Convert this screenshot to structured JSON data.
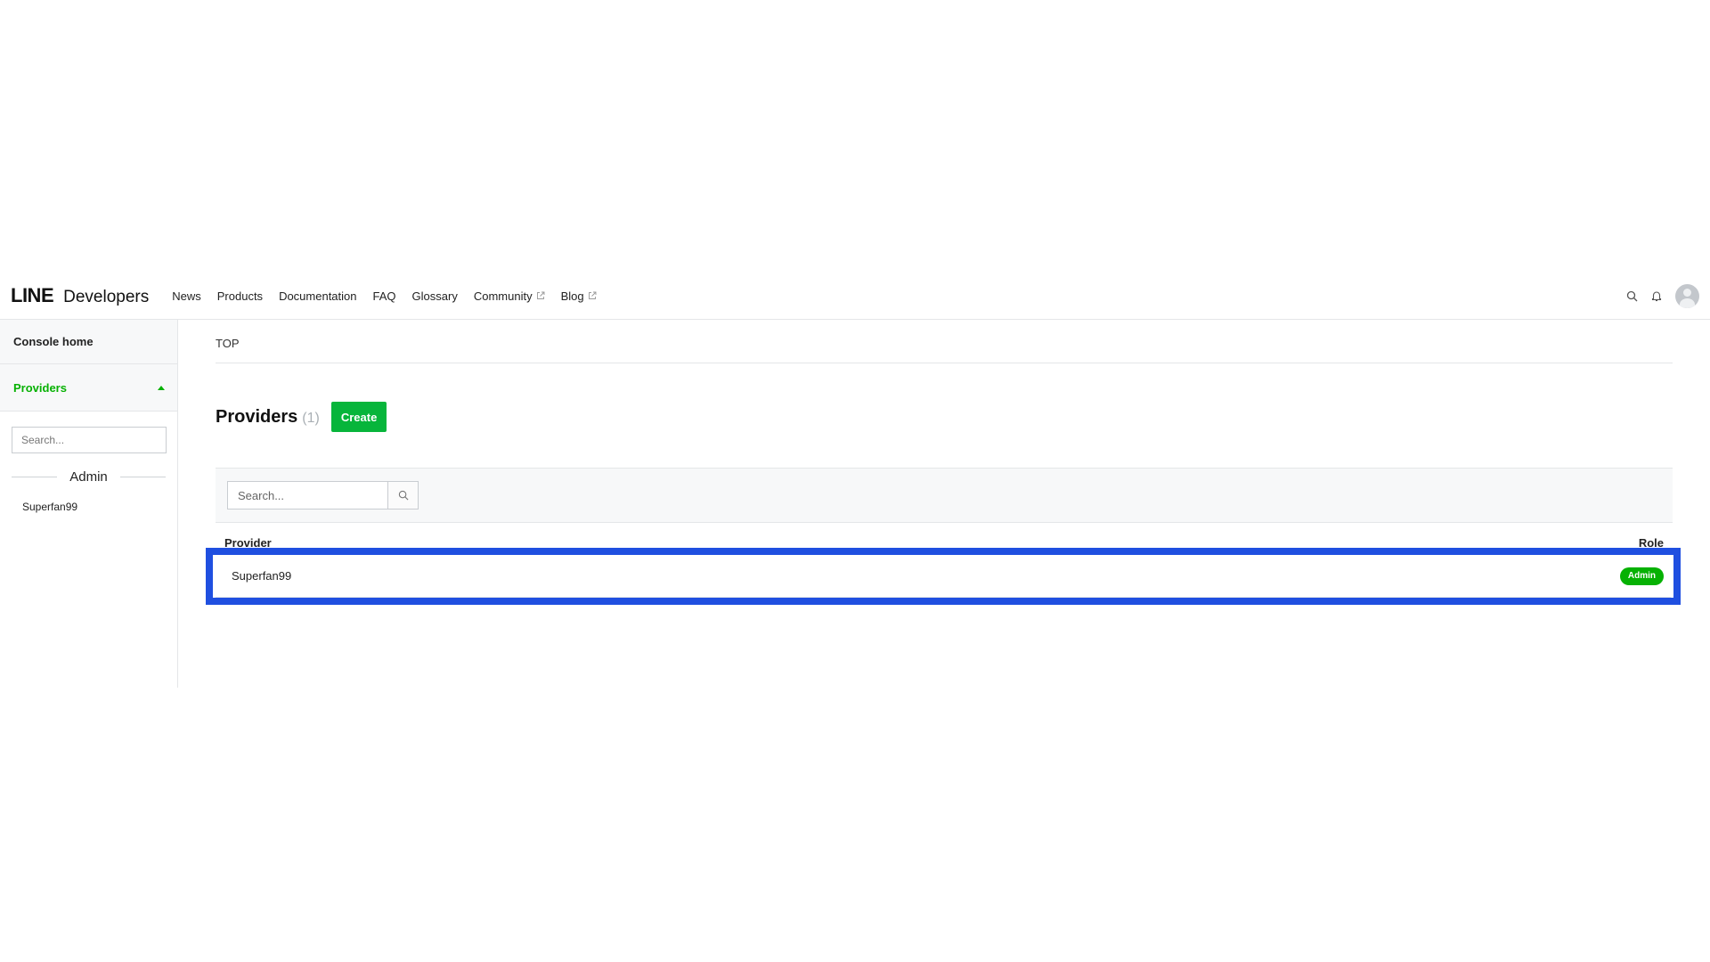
{
  "header": {
    "logo_line": "LINE",
    "logo_developers": "Developers",
    "nav": [
      {
        "label": "News",
        "external": false
      },
      {
        "label": "Products",
        "external": false
      },
      {
        "label": "Documentation",
        "external": false
      },
      {
        "label": "FAQ",
        "external": false
      },
      {
        "label": "Glossary",
        "external": false
      },
      {
        "label": "Community",
        "external": true
      },
      {
        "label": "Blog",
        "external": true
      }
    ],
    "icons": [
      "search-icon",
      "bell-icon",
      "avatar"
    ]
  },
  "sidebar": {
    "console_home": "Console home",
    "providers_label": "Providers",
    "search_placeholder": "Search...",
    "group_label": "Admin",
    "items": [
      {
        "label": "Superfan99"
      }
    ]
  },
  "main": {
    "breadcrumb": "TOP",
    "title": "Providers",
    "count": "(1)",
    "create_label": "Create",
    "search_placeholder": "Search...",
    "columns": {
      "provider": "Provider",
      "role": "Role"
    },
    "rows": [
      {
        "provider": "Superfan99",
        "role": "Admin"
      }
    ]
  },
  "colors": {
    "accent_green": "#06b103",
    "highlight_blue": "#1f4fe0"
  }
}
